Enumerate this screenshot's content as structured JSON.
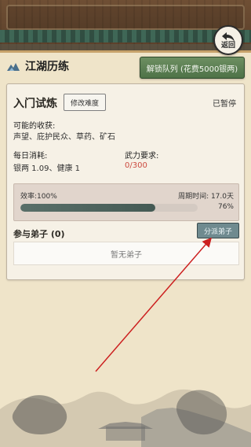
{
  "header": {
    "back_label": "返回"
  },
  "page": {
    "title": "江湖历练"
  },
  "unlock_queue_button": "解锁队列 (花费5000银两)",
  "trial": {
    "name": "入门试炼",
    "difficulty_button": "修改难度",
    "status": "已暂停",
    "rewards_label": "可能的收获:",
    "rewards_value": "声望、庇护民众、草药、矿石",
    "daily_cost_label": "每日消耗:",
    "daily_cost_value": "银两 1.09、健康 1",
    "power_req_label": "武力要求:",
    "power_req_value": "0/300",
    "efficiency_label": "效率:100%",
    "cycle_label": "周期时间: 17.0天",
    "progress_text": "76%",
    "progress_value": 0.76
  },
  "disciples": {
    "label": "参与弟子 (0)",
    "assign_button": "分派弟子",
    "empty_text": "暂无弟子"
  },
  "colors": {
    "accent_green": "#4e7247",
    "accent_teal": "#6f8a8f",
    "arrow_red": "#cc1f1f",
    "power_red": "#cc4a3f"
  },
  "icons": {
    "back": "back-icon",
    "title": "mountain-icon"
  }
}
